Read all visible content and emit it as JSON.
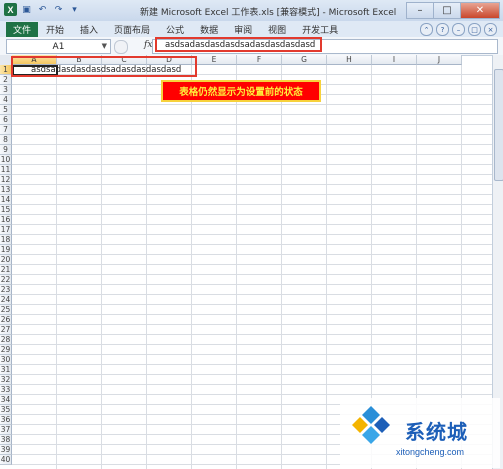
{
  "title": "新建 Microsoft Excel 工作表.xls [兼容模式] - Microsoft Excel",
  "ribbon_tabs": [
    "文件",
    "开始",
    "插入",
    "页面布局",
    "公式",
    "数据",
    "审阅",
    "视图",
    "开发工具"
  ],
  "name_box": "A1",
  "fx_label": "fx",
  "formula_value": "asdsadasdasdasdsadasdasdasdasd",
  "columns": [
    "A",
    "B",
    "C",
    "D",
    "E",
    "F",
    "G",
    "H",
    "I",
    "J"
  ],
  "rows": [
    "1",
    "2",
    "3",
    "4",
    "5",
    "6",
    "7",
    "8",
    "9",
    "10",
    "11",
    "12",
    "13",
    "14",
    "15",
    "16",
    "17",
    "18",
    "19",
    "20",
    "21",
    "22",
    "23",
    "24",
    "25",
    "26",
    "27",
    "28",
    "29",
    "30",
    "31",
    "32",
    "33",
    "34",
    "35",
    "36",
    "37",
    "38",
    "39",
    "40"
  ],
  "cell_a1": "asdsadasdasdasdsadasdasdasdasd",
  "annotation": "表格仍然显示为设置前的状态",
  "watermark": {
    "cn": "系统城",
    "en": "xitongcheng.com"
  }
}
